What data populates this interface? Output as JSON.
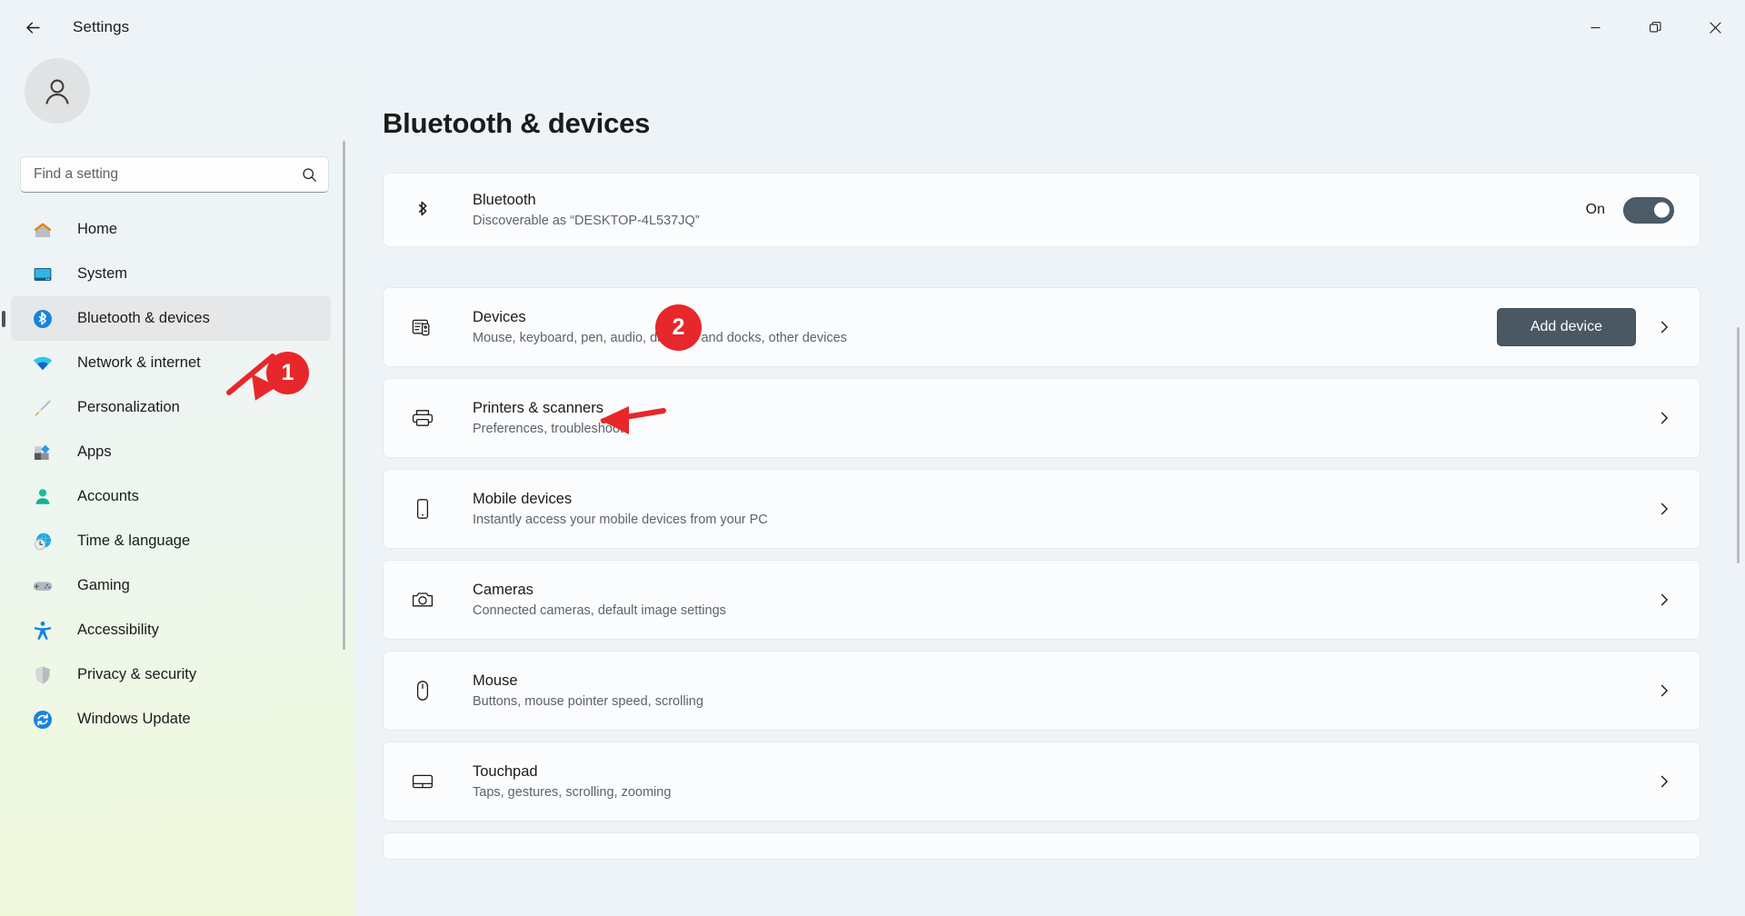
{
  "window": {
    "title": "Settings",
    "back_icon": "back-arrow-icon",
    "controls": {
      "minimize": "minimize-icon",
      "maximize": "restore-icon",
      "close": "close-icon"
    }
  },
  "sidebar": {
    "avatar_icon": "user-avatar-icon",
    "search": {
      "placeholder": "Find a setting",
      "value": "",
      "icon": "search-icon"
    },
    "items": [
      {
        "label": "Home",
        "icon": "home-icon",
        "selected": false
      },
      {
        "label": "System",
        "icon": "system-monitor-icon",
        "selected": false
      },
      {
        "label": "Bluetooth & devices",
        "icon": "bluetooth-icon",
        "selected": true
      },
      {
        "label": "Network & internet",
        "icon": "wifi-icon",
        "selected": false
      },
      {
        "label": "Personalization",
        "icon": "paintbrush-icon",
        "selected": false
      },
      {
        "label": "Apps",
        "icon": "apps-icon",
        "selected": false
      },
      {
        "label": "Accounts",
        "icon": "account-person-icon",
        "selected": false
      },
      {
        "label": "Time & language",
        "icon": "clock-globe-icon",
        "selected": false
      },
      {
        "label": "Gaming",
        "icon": "gamepad-icon",
        "selected": false
      },
      {
        "label": "Accessibility",
        "icon": "accessibility-person-icon",
        "selected": false
      },
      {
        "label": "Privacy & security",
        "icon": "shield-icon",
        "selected": false
      },
      {
        "label": "Windows Update",
        "icon": "update-refresh-icon",
        "selected": false
      }
    ]
  },
  "main": {
    "page_title": "Bluetooth & devices",
    "bluetooth": {
      "title": "Bluetooth",
      "subtitle": "Discoverable as “DESKTOP-4L537JQ”",
      "icon": "bluetooth-icon",
      "toggle_label": "On",
      "toggle_state": "on"
    },
    "rows": [
      {
        "title": "Devices",
        "subtitle": "Mouse, keyboard, pen, audio, displays and docks, other devices",
        "icon": "devices-icon",
        "button": "Add device",
        "chevron": "chevron-right-icon"
      },
      {
        "title": "Printers & scanners",
        "subtitle": "Preferences, troubleshoot",
        "icon": "printer-icon",
        "chevron": "chevron-right-icon"
      },
      {
        "title": "Mobile devices",
        "subtitle": "Instantly access your mobile devices from your PC",
        "icon": "phone-icon",
        "chevron": "chevron-right-icon"
      },
      {
        "title": "Cameras",
        "subtitle": "Connected cameras, default image settings",
        "icon": "camera-icon",
        "chevron": "chevron-right-icon"
      },
      {
        "title": "Mouse",
        "subtitle": "Buttons, mouse pointer speed, scrolling",
        "icon": "mouse-icon",
        "chevron": "chevron-right-icon"
      },
      {
        "title": "Touchpad",
        "subtitle": "Taps, gestures, scrolling, zooming",
        "icon": "touchpad-icon",
        "chevron": "chevron-right-icon"
      }
    ]
  },
  "annotations": {
    "color": "#e8272a",
    "markers": [
      {
        "label": "1",
        "target": "sidebar-item-bluetooth-devices"
      },
      {
        "label": "2",
        "target": "row-printers-scanners"
      }
    ]
  }
}
